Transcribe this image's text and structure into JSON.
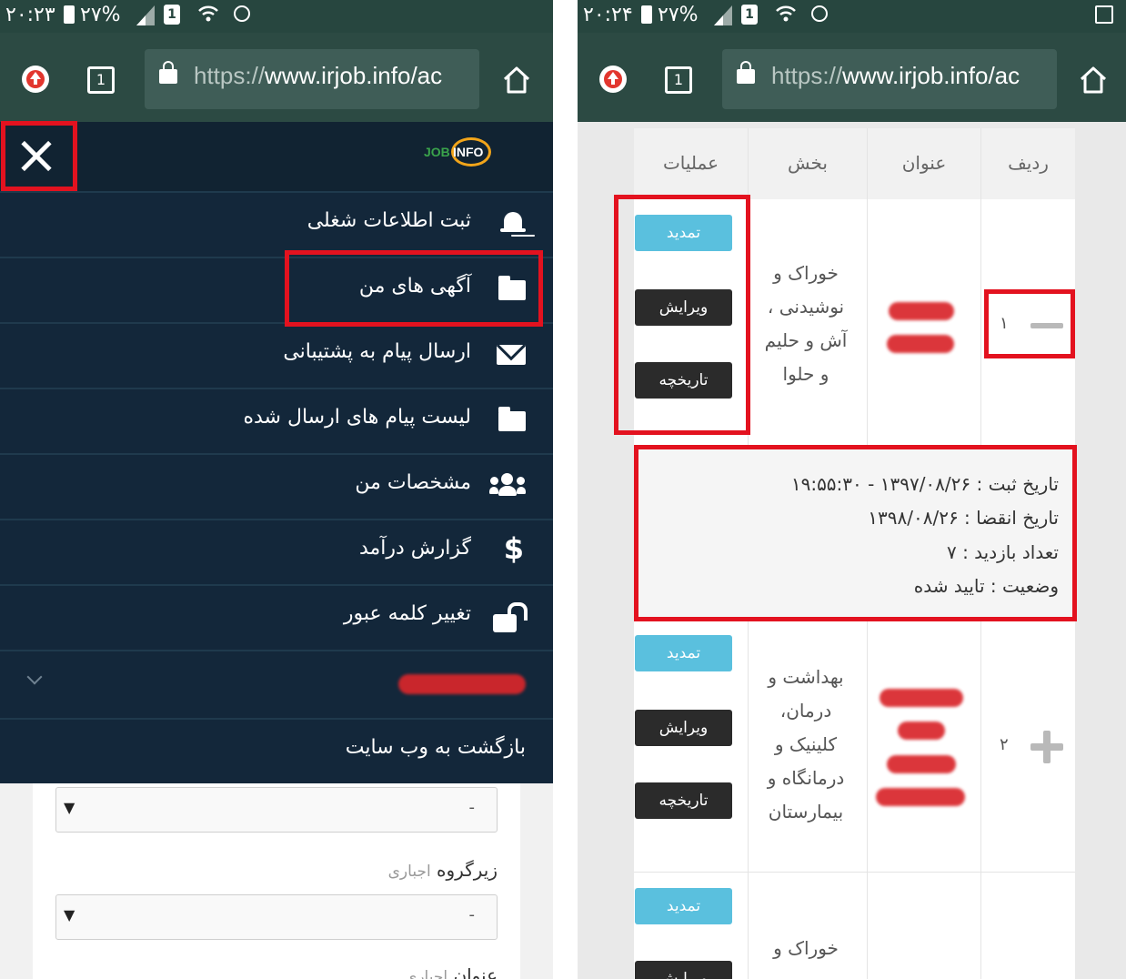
{
  "left": {
    "status": {
      "time": "۲۰:۲۳",
      "battery": "۲۷%",
      "sim": "1"
    },
    "toolbar": {
      "tab_count": "1",
      "url_scheme": "https://",
      "url_host": "www.irjob.info/ac"
    },
    "drawer": {
      "logo_job": "JOB",
      "logo_info": "INFO",
      "items": [
        {
          "label": "ثبت اطلاعات شغلی",
          "icon": "bell-icon"
        },
        {
          "label": "آگهی های من",
          "icon": "folder-icon"
        },
        {
          "label": "ارسال پیام به پشتیبانی",
          "icon": "envelope-icon"
        },
        {
          "label": "لیست پیام های ارسال شده",
          "icon": "folder-icon"
        },
        {
          "label": "مشخصات من",
          "icon": "users-icon"
        },
        {
          "label": "گزارش درآمد",
          "icon": "dollar-icon"
        },
        {
          "label": "تغییر کلمه عبور",
          "icon": "unlock-icon"
        },
        {
          "label": "",
          "icon": "chevron-down-icon"
        },
        {
          "label": "بازگشت به وب سایت",
          "icon": ""
        }
      ]
    },
    "form": {
      "select1_value": "-",
      "subgroup_label": "زیرگروه",
      "required": "اجباری",
      "select2_value": "-",
      "title_label": "عنوان",
      "title_required": "اجباری"
    }
  },
  "right": {
    "status": {
      "time": "۲۰:۲۴",
      "battery": "۲۷%",
      "sim": "1"
    },
    "toolbar": {
      "tab_count": "1",
      "url_scheme": "https://",
      "url_host": "www.irjob.info/ac"
    },
    "table": {
      "headers": {
        "row": "ردیف",
        "title": "عنوان",
        "section": "بخش",
        "operations": "عملیات"
      },
      "buttons": {
        "renew": "تمدید",
        "edit": "ویرایش",
        "history": "تاریخچه"
      },
      "rows": [
        {
          "num": "۱",
          "category_lines": [
            "خوراک و",
            "نوشیدنی ،",
            "آش و حلیم",
            "و حلوا"
          ]
        },
        {
          "num": "۲",
          "category_lines": [
            "بهداشت و",
            "درمان،",
            "کلینیک و",
            "درمانگاه و",
            "بیمارستان"
          ]
        },
        {
          "num": "",
          "category_lines": [
            "خوراک و"
          ]
        }
      ],
      "details": {
        "registered": "تاریخ ثبت : ۱۳۹۷/۰۸/۲۶ - ۱۹:۵۵:۳۰",
        "expires": "تاریخ انقضا : ۱۳۹۸/۰۸/۲۶",
        "visits": "تعداد بازدید : ۷",
        "status": "وضعیت : تایید شده"
      }
    }
  },
  "colors": {
    "toolbar": "#2c4a43",
    "drawer": "#13273a",
    "highlight": "#e3121f",
    "renew_button": "#5ac0de",
    "dark_button": "#2b2b2b"
  }
}
